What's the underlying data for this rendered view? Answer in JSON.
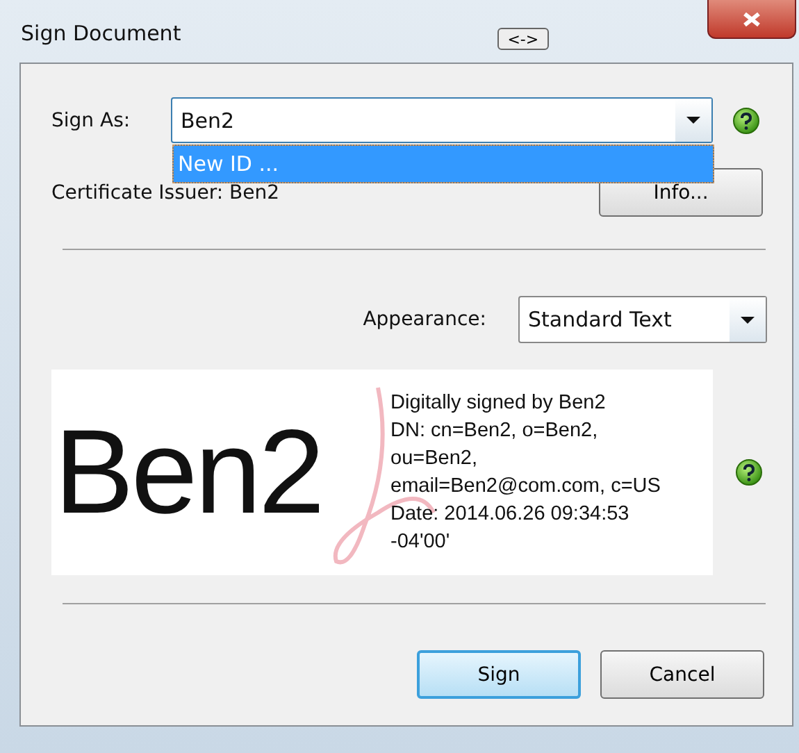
{
  "window": {
    "title": "Sign Document",
    "title_button": "<->"
  },
  "sign_as": {
    "label": "Sign As:",
    "value": "Ben2",
    "open": true,
    "options": [
      {
        "label": "New ID ...",
        "selected": true
      }
    ]
  },
  "certificate_issuer": "Certificate Issuer: Ben2",
  "info_button": "Info...",
  "appearance": {
    "label": "Appearance:",
    "value": "Standard Text"
  },
  "preview": {
    "name": "Ben2",
    "details": [
      "Digitally signed by Ben2",
      "DN: cn=Ben2, o=Ben2,",
      "ou=Ben2,",
      "email=Ben2@com.com, c=US",
      "Date: 2014.06.26 09:34:53",
      "-04'00'"
    ]
  },
  "buttons": [
    {
      "label": "Sign",
      "default": true
    },
    {
      "label": "Cancel",
      "default": false
    }
  ]
}
